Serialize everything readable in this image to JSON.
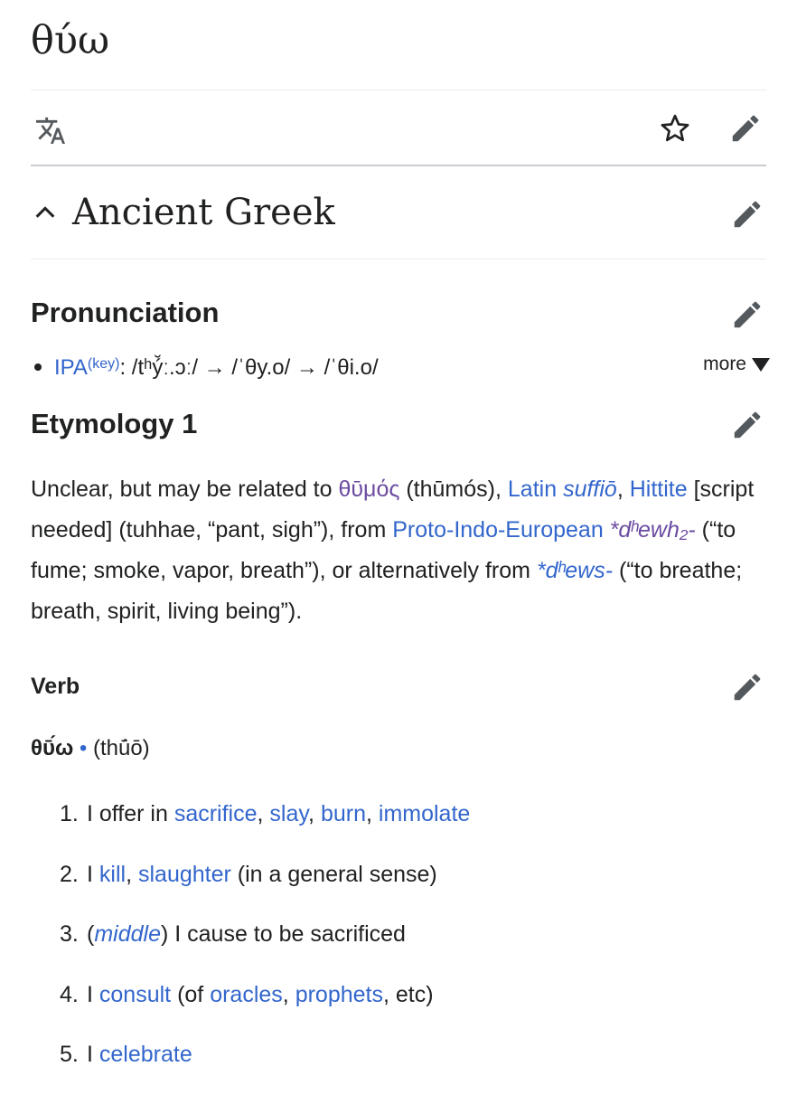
{
  "page": {
    "title": "θύω"
  },
  "toolbar": {
    "translate_icon": "translate-icon",
    "watch_icon": "star-icon",
    "edit_icon": "pencil-icon"
  },
  "section": {
    "language": "Ancient Greek",
    "pronunciation": {
      "heading": "Pronunciation",
      "ipa_label": "IPA",
      "key_label": "(key)",
      "ipa_text": ": /tʰý̆ː.ɔː/ → /ˈθy.o/ → /ˈθi.o/",
      "more_label": "more"
    },
    "etymology": {
      "heading": "Etymology 1",
      "t1": "Unclear, but may be related to ",
      "thumos": "θῡμός",
      "t2": " (thūmós), ",
      "latin": "Latin ",
      "suffio": "suffiō",
      "t3": ", ",
      "hittite": "Hittite",
      "t4": " [script needed] (tuhhae, “pant, sigh”), from ",
      "pie": "Proto-Indo-European",
      "t5": " ",
      "root1": "*dʰewh₂-",
      "t6": " (“to fume; smoke, vapor, breath”), or alternatively from ",
      "root2": "*dʰews-",
      "t7": " (“to breathe; breath, spirit, living being”)."
    },
    "verb": {
      "heading": "Verb",
      "headword": "θῡ́ω",
      "dot": " • ",
      "translit": "(thū́ō)",
      "senses": [
        {
          "num": "1.",
          "parts": [
            "I offer in ",
            "sacrifice",
            ", ",
            "slay",
            ", ",
            "burn",
            ", ",
            "immolate"
          ]
        },
        {
          "num": "2.",
          "parts": [
            "I ",
            "kill",
            ", ",
            "slaughter",
            " (in a general sense)"
          ]
        },
        {
          "num": "3.",
          "parts": [
            "(",
            "middle",
            ") I cause to be sacrificed"
          ]
        },
        {
          "num": "4.",
          "parts": [
            "I ",
            "consult",
            " (of ",
            "oracles",
            ", ",
            "prophets",
            ", etc)"
          ]
        },
        {
          "num": "5.",
          "parts": [
            "I ",
            "celebrate"
          ]
        }
      ]
    }
  }
}
